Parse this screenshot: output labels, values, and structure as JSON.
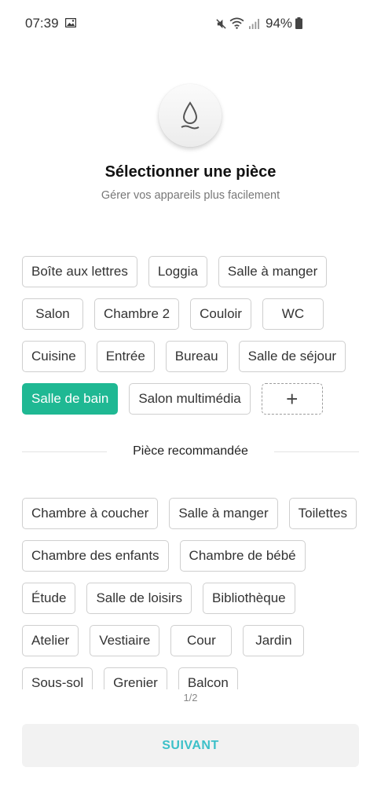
{
  "status_bar": {
    "time": "07:39",
    "battery_percent": "94%",
    "icons": [
      "gallery-icon",
      "mute-icon",
      "wifi-icon",
      "signal-icon",
      "battery-icon"
    ]
  },
  "header": {
    "icon": "water-drop-icon",
    "title": "Sélectionner une pièce",
    "subtitle": "Gérer vos appareils plus facilement"
  },
  "rooms": [
    {
      "label": "Boîte aux lettres",
      "selected": false
    },
    {
      "label": "Loggia",
      "selected": false
    },
    {
      "label": "Salle à manger",
      "selected": false
    },
    {
      "label": "Salon",
      "selected": false
    },
    {
      "label": "Chambre 2",
      "selected": false
    },
    {
      "label": "Couloir",
      "selected": false
    },
    {
      "label": "WC",
      "selected": false
    },
    {
      "label": "Cuisine",
      "selected": false
    },
    {
      "label": "Entrée",
      "selected": false
    },
    {
      "label": "Bureau",
      "selected": false
    },
    {
      "label": "Salle de séjour",
      "selected": false
    },
    {
      "label": "Salle de bain",
      "selected": true
    },
    {
      "label": "Salon multimédia",
      "selected": false
    }
  ],
  "add_chip": {
    "label": "+"
  },
  "recommended": {
    "heading": "Pièce recommandée",
    "rooms": [
      "Chambre à coucher",
      "Salle à manger",
      "Toilettes",
      "Chambre des enfants",
      "Chambre de bébé",
      "Étude",
      "Salle de loisirs",
      "Bibliothèque",
      "Atelier",
      "Vestiaire",
      "Cour",
      "Jardin",
      "Sous-sol",
      "Grenier",
      "Balcon"
    ]
  },
  "pager": "1/2",
  "next_button": "SUIVANT",
  "colors": {
    "accent": "#1fb893",
    "button_text": "#3cc0c8"
  }
}
